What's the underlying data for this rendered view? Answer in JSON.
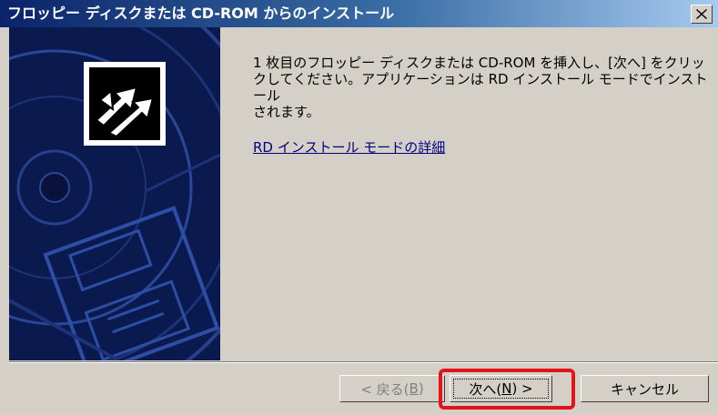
{
  "window": {
    "title": "フロッピー ディスクまたは CD-ROM からのインストール",
    "close_glyph": "×"
  },
  "content": {
    "instruction_lines": [
      "1 枚目のフロッピー ディスクまたは CD-ROM を挿入し、[次へ] をクリッ",
      "クしてください。アプリケーションは RD インストール モードでインストール",
      "されます。"
    ],
    "details_link": "RD インストール モードの詳細"
  },
  "buttons": {
    "back": {
      "text": "< 戻る(",
      "key": "B",
      "suffix": ")",
      "enabled": false
    },
    "next": {
      "text": "次へ(",
      "key": "N",
      "suffix": ") >",
      "enabled": true
    },
    "cancel": {
      "label": "キャンセル",
      "enabled": true
    }
  },
  "annotation": {
    "highlight_color": "#e1141b"
  },
  "icons": {
    "wizard": "install-wizard-icon",
    "close": "close-icon"
  },
  "colors": {
    "title_bar_start": "#0a246a",
    "title_bar_end": "#a6caf0",
    "dialog_bg": "#d4d0c8",
    "sidebar_bg": "#0b1a4e",
    "link": "#000080"
  }
}
